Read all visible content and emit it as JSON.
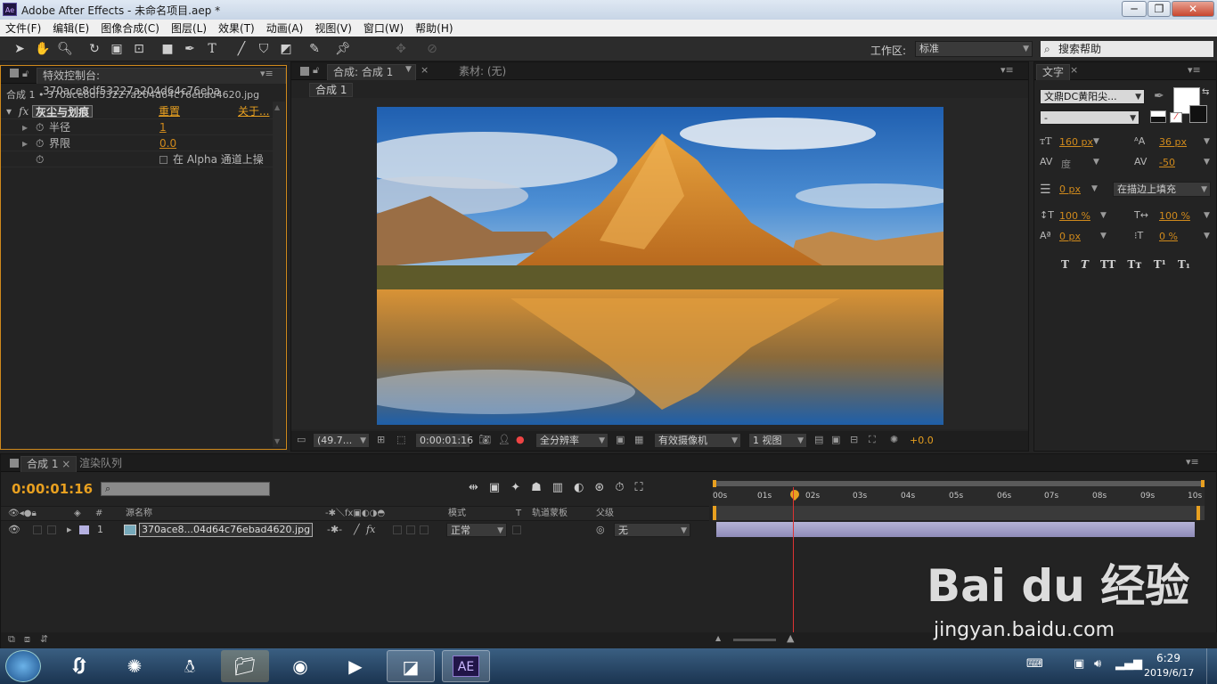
{
  "window": {
    "title": "Adobe After Effects - 未命名项目.aep *",
    "logo_text": "Ae",
    "min": "─",
    "max": "❐",
    "close": "✕"
  },
  "menu": [
    "文件(F)",
    "编辑(E)",
    "图像合成(C)",
    "图层(L)",
    "效果(T)",
    "动画(A)",
    "视图(V)",
    "窗口(W)",
    "帮助(H)"
  ],
  "toolbar": {
    "workspace_label": "工作区:",
    "workspace_value": "标准",
    "search_placeholder": "搜索帮助"
  },
  "effect_controls": {
    "tab_label": "特效控制台: 370ace8df53227a204d64c76eba",
    "layer_path": "合成 1 • 370ace8df53227a204d64c76ebad4620.jpg",
    "effect_name": "灰尘与划痕",
    "reset": "重置",
    "about": "关于...",
    "properties": [
      {
        "name": "半径",
        "value": "1"
      },
      {
        "name": "界限",
        "value": "0.0"
      }
    ],
    "alpha_label": "在 Alpha 通道上操"
  },
  "composition": {
    "tab_label": "合成: 合成 1",
    "footage_label": "素材: (无)",
    "sub_tab": "合成 1",
    "zoom": "(49.7...",
    "timecode": "0:00:01:16",
    "resolution": "全分辨率",
    "camera": "有效摄像机",
    "view": "1 视图",
    "exposure": "+0.0"
  },
  "text_panel": {
    "tab_label": "文字",
    "font": "文鼎DC黄阳尖...",
    "style": "-",
    "size": "160 px",
    "leading": "36 px",
    "kerning": "度",
    "tracking": "-50",
    "stroke": "0 px",
    "stroke_mode": "在描边上填充",
    "vscale": "100 %",
    "hscale": "100 %",
    "baseline": "0 px",
    "tsume": "0 %",
    "styles": [
      "T",
      "T",
      "TT",
      "Tт",
      "T¹",
      "T₁"
    ]
  },
  "timeline": {
    "tab_label": "合成 1",
    "render_queue": "渲染队列",
    "timecode": "0:00:01:16",
    "columns": {
      "source": "源名称",
      "mode": "模式",
      "t": "T",
      "trkmat": "轨道蒙板",
      "parent": "父级",
      "num": "#"
    },
    "layer": {
      "num": "1",
      "name": "370ace8...04d64c76ebad4620.jpg",
      "mode": "正常",
      "parent": "无"
    },
    "ticks": [
      "00s",
      "01s",
      "02s",
      "03s",
      "04s",
      "05s",
      "06s",
      "07s",
      "08s",
      "09s",
      "10s"
    ]
  },
  "taskbar": {
    "time": "6:29",
    "date": "2019/6/17",
    "ae_label": "AE"
  },
  "watermark": {
    "main": "Bai du 经验",
    "sub": "jingyan.baidu.com"
  }
}
